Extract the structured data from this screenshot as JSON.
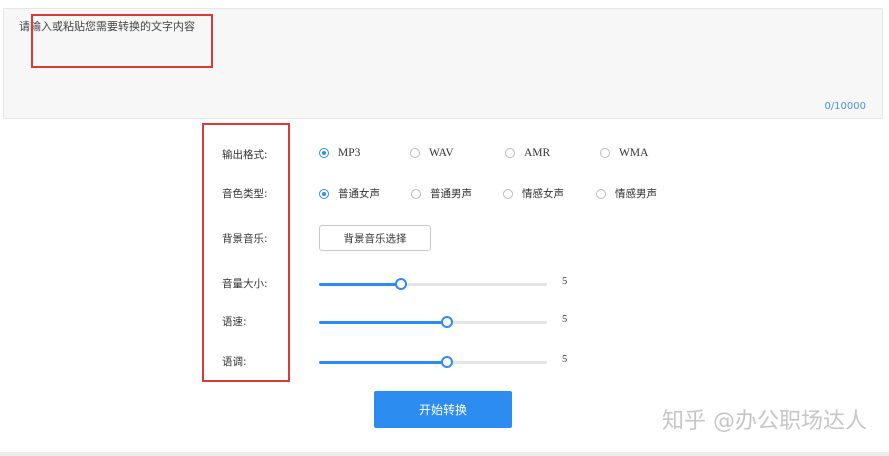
{
  "input": {
    "placeholder": "请输入或粘贴您需要转换的文字内容",
    "counter": "0/10000"
  },
  "form": {
    "format": {
      "label": "输出格式:",
      "options": [
        "MP3",
        "WAV",
        "AMR",
        "WMA"
      ],
      "selected": "MP3"
    },
    "voice": {
      "label": "音色类型:",
      "options": [
        "普通女声",
        "普通男声",
        "情感女声",
        "情感男声"
      ],
      "selected": "普通女声"
    },
    "music": {
      "label": "背景音乐:",
      "button": "背景音乐选择"
    },
    "volume": {
      "label": "音量大小:",
      "value": "5",
      "fraction": 0.36
    },
    "speed": {
      "label": "语速:",
      "value": "5",
      "fraction": 0.56
    },
    "pitch": {
      "label": "语调:",
      "value": "5",
      "fraction": 0.56
    }
  },
  "action": {
    "start": "开始转换"
  },
  "watermark": "知乎 @办公职场达人",
  "colors": {
    "accent": "#2d8cf0",
    "highlight_box": "#d93a3a",
    "text_area_bg": "#f7f7f7"
  }
}
